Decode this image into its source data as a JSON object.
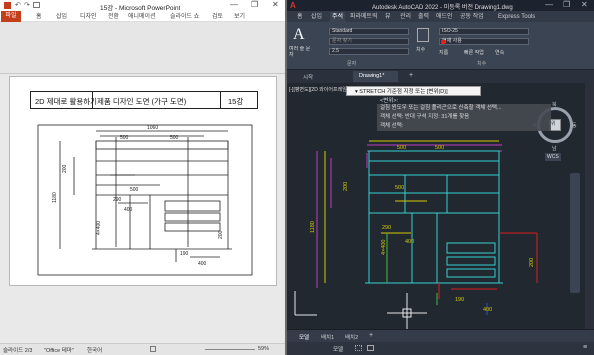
{
  "ppt": {
    "title": "15강 - Microsoft PowerPoint",
    "tabs": [
      "파일",
      "홈",
      "삽입",
      "디자인",
      "전환",
      "애니메이션",
      "슬라이드 쇼",
      "검토",
      "보기"
    ],
    "slide": {
      "title_left": "2D 제대로 활용하기",
      "title_mid": "제품 디자인 도면 (가구 도면)",
      "title_right": "15강",
      "dims": [
        "1060",
        "500",
        "500",
        "200",
        "500",
        "290",
        "400",
        "1180",
        "4×400",
        "200",
        "190",
        "400"
      ]
    },
    "status": {
      "slide": "슬라이드 2/3",
      "theme": "\"Office 테마\"",
      "lang": "한국어",
      "zoom": "59%"
    }
  },
  "acad": {
    "title": "Autodesk AutoCAD 2022 - 미등록 버전    Drawing1.dwg",
    "tabs": [
      "홈",
      "삽입",
      "주석",
      "파라메트릭",
      "뷰",
      "관리",
      "출력",
      "애드인",
      "공동 작업",
      "Express Tools"
    ],
    "ribbon": {
      "text_label": "여러 줄 문자",
      "style": "Standard",
      "find": "문자 찾기",
      "height": "2.5",
      "dim_label": "치수",
      "dimstyle": "ISO-25",
      "layer": "현재 사용",
      "panel_text": "문자",
      "panel_dim": "치수",
      "leader": "지름",
      "quick": "빠른 작업",
      "continue": "연속"
    },
    "doc_tabs": [
      "시작",
      "Drawing1*"
    ],
    "view_label": "[-][평면도][2D 와이어프레임]",
    "tooltip": "▾ STRETCH 기준점 지정 또는 [변위(D)]",
    "tooltip_sub": "<변위>:",
    "cmd_lines": [
      "걸침 윈도우 또는 걸침 폴리곤으로 신축할 객체 선택...",
      "객체 선택: 반대 구석 지정: 31개를 찾음",
      "객체 선택:"
    ],
    "dims": [
      "1180",
      "500",
      "500",
      "200",
      "500",
      "290",
      "400",
      "4×400",
      "190",
      "200",
      "400"
    ],
    "wcs": "WCS",
    "compass": {
      "n": "북",
      "w": "서",
      "e": "동",
      "s": "남",
      "top": "위"
    },
    "status": {
      "model": "모델",
      "layout1": "배치1",
      "layout2": "배치2"
    },
    "bottom_model": "모델",
    "colors": {
      "cyan": "#33d1d1",
      "magenta": "#c03cc0",
      "yellow": "#d4c800",
      "red": "#d62020",
      "green": "#36c040",
      "blue": "#3050d0",
      "white": "#e6e6e6"
    }
  }
}
